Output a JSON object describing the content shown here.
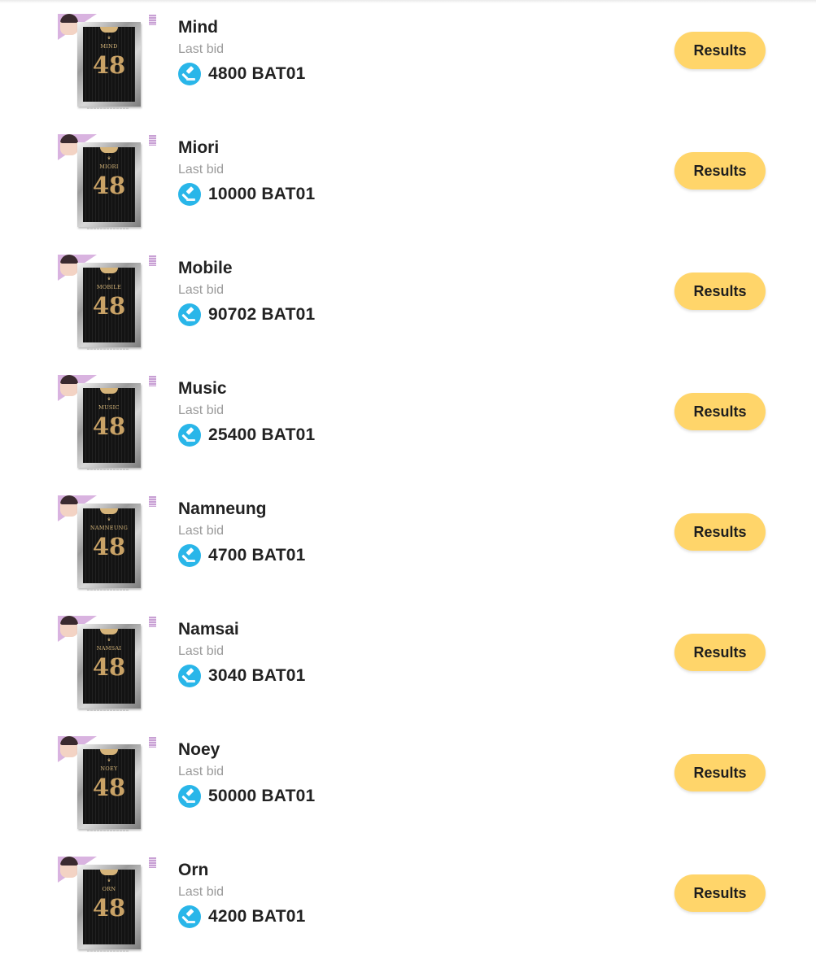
{
  "auction_list": {
    "last_bid_label": "Last bid",
    "results_label": "Results",
    "items": [
      {
        "name": "Mind",
        "jersey_name": "MIND",
        "jersey_number": "48",
        "amount": "4800 BAT01"
      },
      {
        "name": "Miori",
        "jersey_name": "MIORI",
        "jersey_number": "48",
        "amount": "10000 BAT01"
      },
      {
        "name": "Mobile",
        "jersey_name": "MOBILE",
        "jersey_number": "48",
        "amount": "90702 BAT01"
      },
      {
        "name": "Music",
        "jersey_name": "MUSIC",
        "jersey_number": "48",
        "amount": "25400 BAT01"
      },
      {
        "name": "Namneung",
        "jersey_name": "NAMNEUNG",
        "jersey_number": "48",
        "amount": "4700 BAT01"
      },
      {
        "name": "Namsai",
        "jersey_name": "NAMSAI",
        "jersey_number": "48",
        "amount": "3040 BAT01"
      },
      {
        "name": "Noey",
        "jersey_name": "NOEY",
        "jersey_number": "48",
        "amount": "50000 BAT01"
      },
      {
        "name": "Orn",
        "jersey_name": "ORN",
        "jersey_number": "48",
        "amount": "4200 BAT01"
      }
    ]
  },
  "colors": {
    "results_button": "#ffd56a",
    "coin": "#29b6e9",
    "name_text": "#222222",
    "label_text": "#9a9a9a"
  },
  "icons": {
    "coin": "auction-gavel-icon"
  }
}
